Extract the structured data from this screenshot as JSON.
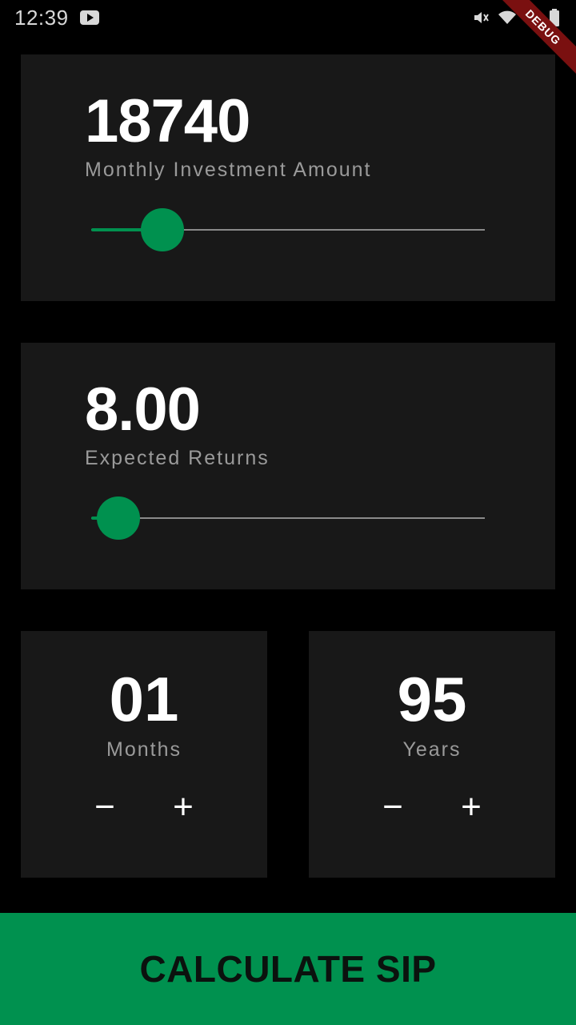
{
  "status_bar": {
    "time": "12:39",
    "icons": [
      "youtube-icon",
      "mute-icon",
      "wifi-icon",
      "signal-icon",
      "battery-icon"
    ]
  },
  "debug_banner": "DEBUG",
  "investment": {
    "value": "18740",
    "label": "Monthly Investment Amount",
    "slider_fraction": 0.18
  },
  "returns": {
    "value": "8.00",
    "label": "Expected Returns",
    "slider_fraction": 0.07
  },
  "months": {
    "value": "01",
    "label": "Months",
    "minus": "−",
    "plus": "+"
  },
  "years": {
    "value": "95",
    "label": "Years",
    "minus": "−",
    "plus": "+"
  },
  "calculate_button": "CALCULATE SIP",
  "colors": {
    "accent": "#00914f",
    "card": "#181818",
    "background": "#000000",
    "label": "#9a9a9a"
  }
}
